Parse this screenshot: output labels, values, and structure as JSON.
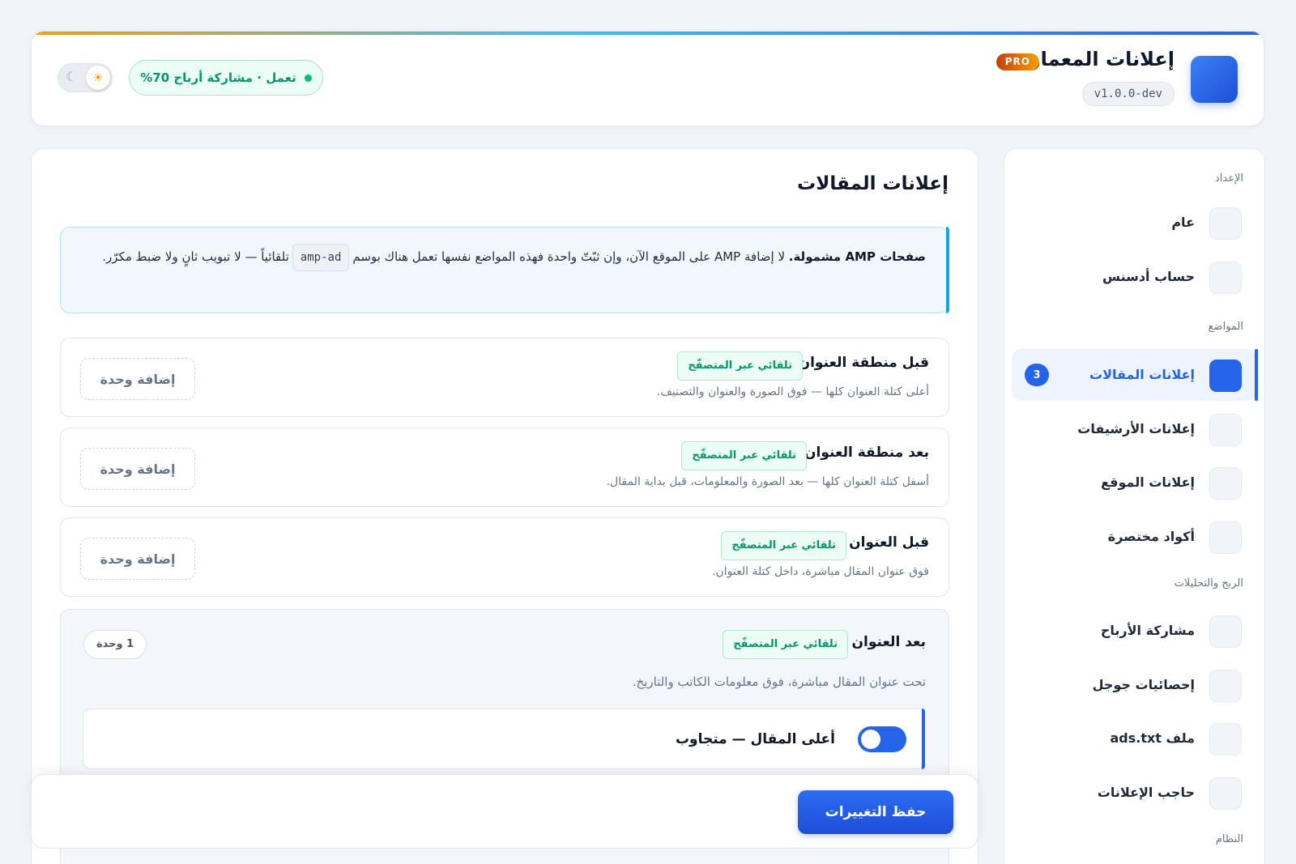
{
  "header": {
    "title": "إعلانات المعمار",
    "pro_badge": "PRO",
    "version": "v1.0.0-dev",
    "status": "تعمل · مشاركة أرباح 70%",
    "theme_toggle": {
      "light_icon": "sun-icon",
      "dark_icon": "moon-icon",
      "selected": "light"
    }
  },
  "sidebar": {
    "sections": {
      "setup": "الإعداد",
      "placements": "المواضع",
      "profit": "الربح والتحليلات",
      "system": "النظام"
    },
    "items": [
      {
        "label": "عام"
      },
      {
        "label": "حساب أدسنس"
      },
      {
        "label": "إعلانات المقالات",
        "active": true,
        "count": "3"
      },
      {
        "label": "إعلانات الأرشيفات"
      },
      {
        "label": "إعلانات الموقع"
      },
      {
        "label": "أكواد مختصرة"
      },
      {
        "label": "مشاركة الأرباح"
      },
      {
        "label": "إحصائيات جوجل"
      },
      {
        "label": "ملف ads.txt"
      },
      {
        "label": "حاجب الإعلانات"
      }
    ]
  },
  "main": {
    "title": "إعلانات المقالات",
    "notice": {
      "bold": "صفحات AMP مشمولة.",
      "text_before_code": " لا إضافة AMP على الموقع الآن، وإن ثبّتّ واحدة فهذه المواضع نفسها تعمل هناك بوسم",
      "code": "amp-ad",
      "text_after_code": "تلقائياً — لا تبويب ثانٍ ولا ضبط مكرّر."
    },
    "slots": [
      {
        "title": "قبل منطقة العنوان",
        "tag": "تلقائي عبر المتصفّح",
        "desc": "أعلى كتلة العنوان كلها — فوق الصورة والعنوان والتصنيف.",
        "add_label": "إضافة وحدة"
      },
      {
        "title": "بعد منطقة العنوان",
        "tag": "تلقائي عبر المتصفّح",
        "desc": "أسفل كتلة العنوان كلها — بعد الصورة والمعلومات، قبل بداية المقال.",
        "add_label": "إضافة وحدة"
      },
      {
        "title": "قبل العنوان",
        "tag": "تلقائي عبر المتصفّح",
        "desc": "فوق عنوان المقال مباشرة، داخل كتلة العنوان.",
        "add_label": "إضافة وحدة"
      }
    ],
    "expanded_slot": {
      "title": "بعد العنوان",
      "tag": "تلقائي عبر المتصفّح",
      "unit_count": "1 وحدة",
      "desc": "تحت عنوان المقال مباشرة، فوق معلومات الكاتب والتاريخ.",
      "units": [
        {
          "name": "أعلى المقال — متجاوب",
          "enabled": true
        }
      ]
    }
  },
  "footer": {
    "save_label": "حفظ التغييرات"
  },
  "colors": {
    "accent": "#2563eb",
    "success": "#10b981",
    "pro": "#f59e0b",
    "background": "#f1f4f9"
  }
}
